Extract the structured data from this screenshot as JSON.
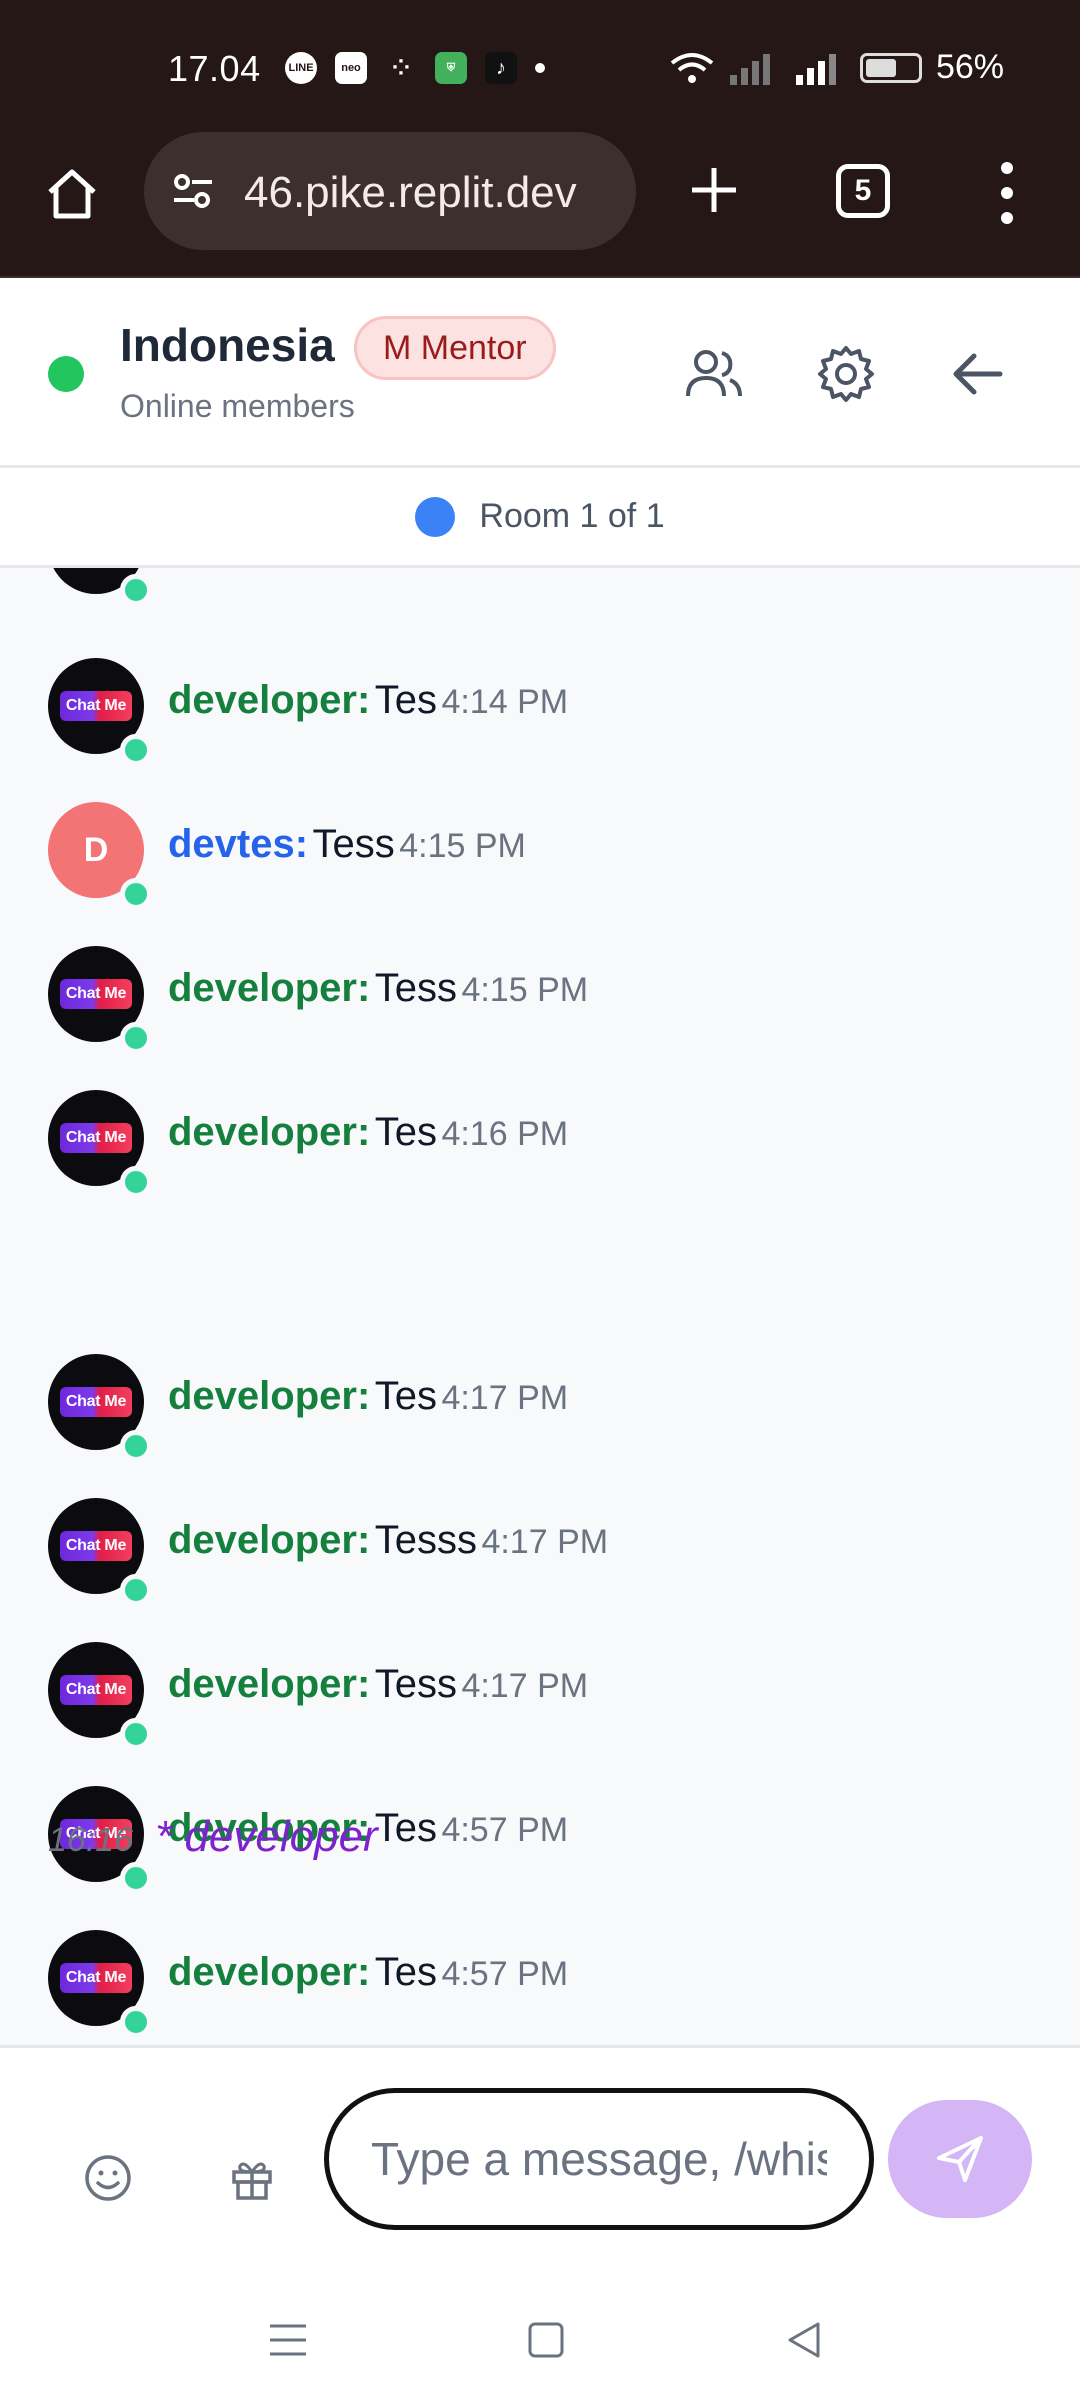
{
  "status_bar": {
    "time": "17.04",
    "icons": [
      "line-icon",
      "neo-icon",
      "grid-icon",
      "shield-icon",
      "tiktok-icon",
      "dot-icon"
    ],
    "icon_labels": {
      "line": "LINE",
      "neo": "neo"
    },
    "battery": "56%"
  },
  "browser": {
    "url": "46.pike.replit.dev",
    "tab_count": "5"
  },
  "header": {
    "title": "Indonesia",
    "badge": "M Mentor",
    "subtitle": "Online members"
  },
  "room_bar": {
    "label": "Room 1 of 1"
  },
  "avatar_logo_text": "Chat Me",
  "messages": [
    {
      "user": "developer:",
      "text": "Tes",
      "time": "4:14 PM",
      "avatar": "logo",
      "color": "green"
    },
    {
      "user": "devtes:",
      "text": "Tess",
      "time": "4:15 PM",
      "avatar": "D",
      "color": "blue"
    },
    {
      "user": "developer:",
      "text": "Tess",
      "time": "4:15 PM",
      "avatar": "logo",
      "color": "green"
    },
    {
      "user": "developer:",
      "text": "Tes",
      "time": "4:16 PM",
      "avatar": "logo",
      "color": "green"
    },
    {
      "user": "developer:",
      "text": "Tes",
      "time": "4:17 PM",
      "avatar": "logo",
      "color": "green"
    },
    {
      "user": "developer:",
      "text": "Tesss",
      "time": "4:17 PM",
      "avatar": "logo",
      "color": "green"
    },
    {
      "user": "developer:",
      "text": "Tess",
      "time": "4:17 PM",
      "avatar": "logo",
      "color": "green"
    },
    {
      "user": "developer:",
      "text": "Tes",
      "time": "4:57 PM",
      "avatar": "logo",
      "color": "green"
    },
    {
      "user": "developer:",
      "text": "Tes",
      "time": "4:57 PM",
      "avatar": "logo",
      "color": "green"
    }
  ],
  "system_message": {
    "time": "16:16",
    "text": "* developer"
  },
  "input": {
    "placeholder": "Type a message, /whisper"
  },
  "colors": {
    "status_bg": "#241716",
    "online": "#22c55e",
    "room_dot": "#3b82f6",
    "user_green": "#15803d",
    "user_blue": "#2563eb",
    "system_purple": "#7e22ce",
    "send_button": "#d4b5f5"
  }
}
